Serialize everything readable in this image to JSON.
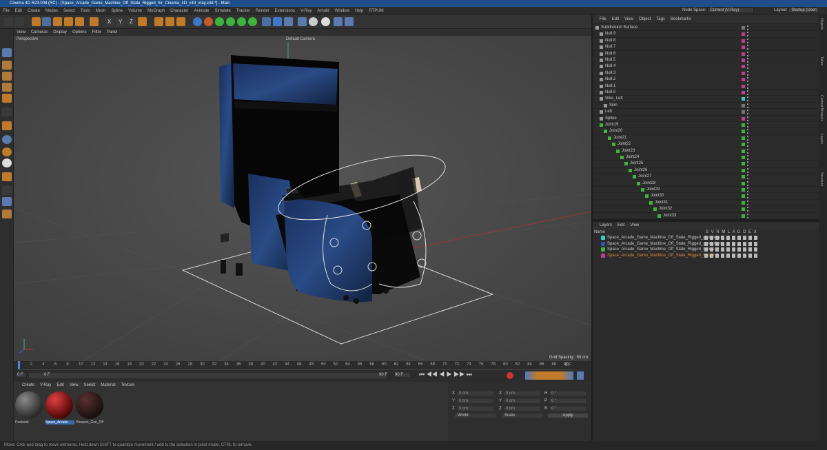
{
  "window": {
    "title": "Cinema 4D R23.008 (RC) - [Space_Arcade_Game_Machine_Off_State_Rigged_for_Cinema_4D_c4d_vray.c4d *] - Main"
  },
  "menu": [
    "File",
    "Edit",
    "Create",
    "Modes",
    "Select",
    "Tools",
    "Mesh",
    "Spline",
    "Volume",
    "MoGraph",
    "Character",
    "Animate",
    "Simulate",
    "Tracker",
    "Render",
    "Extensions",
    "V-Ray",
    "Arnold",
    "Window",
    "Help",
    "RTPUM"
  ],
  "node_space": {
    "label": "Node Space:",
    "value": "Current (V-Ray)"
  },
  "layout": {
    "label": "Layout:",
    "value": "Startup (User)"
  },
  "viewport": {
    "menu": [
      "View",
      "Cameras",
      "Display",
      "Options",
      "Filter",
      "Panel"
    ],
    "label": "Perspective",
    "camera": "Default Camera",
    "grid_spacing": "Grid Spacing : 50 cm"
  },
  "timeline": {
    "ticks": [
      "0",
      "2",
      "4",
      "6",
      "8",
      "10",
      "12",
      "14",
      "16",
      "18",
      "20",
      "22",
      "24",
      "26",
      "28",
      "30",
      "32",
      "34",
      "36",
      "38",
      "40",
      "42",
      "44",
      "46",
      "48",
      "50",
      "52",
      "54",
      "56",
      "58",
      "60",
      "62",
      "64",
      "66",
      "68",
      "70",
      "72",
      "74",
      "76",
      "78",
      "80",
      "82",
      "84",
      "86",
      "88",
      "90"
    ],
    "current": "0 F",
    "start": "0 F",
    "end": "90 F",
    "end2": "90 F",
    "frame_field": "0 F"
  },
  "object_manager": {
    "menu": [
      "File",
      "Edit",
      "View",
      "Object",
      "Tags",
      "Bookmarks"
    ],
    "rows": [
      {
        "name": "Subdivision Surface",
        "indent": 0,
        "color": "#777"
      },
      {
        "name": "Null.9",
        "indent": 1,
        "color": "#c23c8f"
      },
      {
        "name": "Null.8",
        "indent": 1,
        "color": "#c23c8f"
      },
      {
        "name": "Null.7",
        "indent": 1,
        "color": "#c23c8f"
      },
      {
        "name": "Null.6",
        "indent": 1,
        "color": "#c23c8f"
      },
      {
        "name": "Null.5",
        "indent": 1,
        "color": "#c23c8f"
      },
      {
        "name": "Null.4",
        "indent": 1,
        "color": "#c23c8f"
      },
      {
        "name": "Null.3",
        "indent": 1,
        "color": "#c23c8f"
      },
      {
        "name": "Null.2",
        "indent": 1,
        "color": "#c23c8f"
      },
      {
        "name": "Null.1",
        "indent": 1,
        "color": "#c23c8f"
      },
      {
        "name": "Null.0",
        "indent": 1,
        "color": "#c23c8f"
      },
      {
        "name": "Wire_Left",
        "indent": 1,
        "color": "#3fc6c8"
      },
      {
        "name": "Skin",
        "indent": 2,
        "color": "#777"
      },
      {
        "name": "Left",
        "indent": 1,
        "color": "#777"
      },
      {
        "name": "Spline",
        "indent": 1,
        "color": "#c23c8f"
      },
      {
        "name": "Joint19",
        "indent": 1,
        "color": "#3db53d"
      },
      {
        "name": "Joint20",
        "indent": 2,
        "color": "#3db53d"
      },
      {
        "name": "Joint21",
        "indent": 3,
        "color": "#3db53d"
      },
      {
        "name": "Joint22",
        "indent": 4,
        "color": "#3db53d"
      },
      {
        "name": "Joint23",
        "indent": 5,
        "color": "#3db53d"
      },
      {
        "name": "Joint24",
        "indent": 6,
        "color": "#3db53d"
      },
      {
        "name": "Joint25",
        "indent": 7,
        "color": "#3db53d"
      },
      {
        "name": "Joint26",
        "indent": 8,
        "color": "#3db53d"
      },
      {
        "name": "Joint27",
        "indent": 9,
        "color": "#3db53d"
      },
      {
        "name": "Joint28",
        "indent": 10,
        "color": "#3db53d"
      },
      {
        "name": "Joint29",
        "indent": 11,
        "color": "#3db53d"
      },
      {
        "name": "Joint30",
        "indent": 12,
        "color": "#3db53d"
      },
      {
        "name": "Joint31",
        "indent": 13,
        "color": "#3db53d"
      },
      {
        "name": "Joint32",
        "indent": 14,
        "color": "#3db53d"
      },
      {
        "name": "Joint33",
        "indent": 15,
        "color": "#3db53d"
      }
    ]
  },
  "layer_manager": {
    "menu": [
      "Layers",
      "Edit",
      "View"
    ],
    "header": {
      "name": "Name",
      "cols": "S V R M L A G D E X"
    },
    "rows": [
      {
        "name": "Space_Arcade_Game_Machine_Off_State_Rigged_geometry",
        "color": "#3fc6c8",
        "text_color": "#c8c8c8"
      },
      {
        "name": "Space_Arcade_Game_Machine_Off_State_Rigged_controllers",
        "color": "#2a4fb5",
        "text_color": "#c8c8c8"
      },
      {
        "name": "Space_Arcade_Game_Machine_Off_State_Rigged_bones",
        "color": "#3db53d",
        "text_color": "#c8c8c8"
      },
      {
        "name": "Space_Arcade_Game_Machine_Off_State_Rigged_helpers",
        "color": "#c23c8f",
        "text_color": "#e08a3a"
      }
    ]
  },
  "material_manager": {
    "menu": [
      "Create",
      "V-Ray",
      "Edit",
      "View",
      "Select",
      "Material",
      "Texture"
    ],
    "materials": [
      {
        "name": "Pedestal",
        "ball": "radial-gradient(circle at 35% 30%,#8a8a8a,#2a2a2a 70%)"
      },
      {
        "name": "Space_Arcade",
        "ball": "radial-gradient(circle at 35% 30%,#e04040,#5a0a0a 65%,#1a0505)"
      },
      {
        "name": "Weapon_Gun_Off",
        "ball": "radial-gradient(circle at 35% 30%,#5a3030,#1a1010 70%)"
      }
    ]
  },
  "attributes": {
    "rows": [
      [
        "X",
        "0 cm",
        "X",
        "0 cm",
        "H",
        "0 °"
      ],
      [
        "Y",
        "0 cm",
        "Y",
        "0 cm",
        "P",
        "0 °"
      ],
      [
        "Z",
        "0 cm",
        "Z",
        "0 cm",
        "B",
        "0 °"
      ]
    ],
    "mode1": "World",
    "mode2": "Scale",
    "apply": "Apply"
  },
  "status": "Move: Click and drag to move elements. Hold down SHIFT to quantize movement / add to the selection in point mode, CTRL to remove.",
  "right_tabs": [
    "Objects",
    "Takes",
    "Content Browser",
    "Layers",
    "Structure"
  ]
}
